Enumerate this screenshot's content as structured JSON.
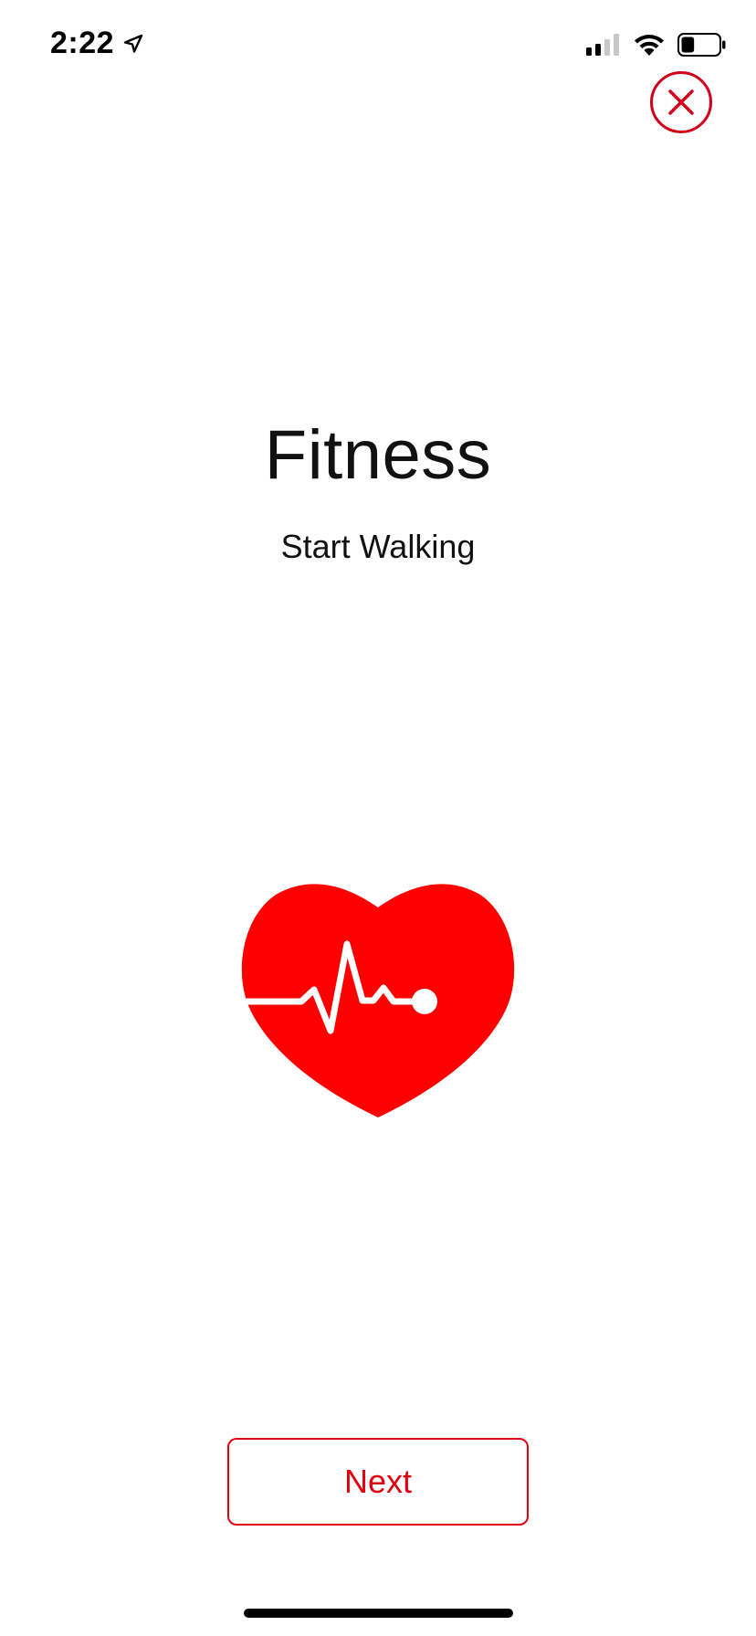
{
  "status_bar": {
    "time": "2:22",
    "location_icon": "location-arrow-icon",
    "signal_icon": "cellular-signal-icon",
    "wifi_icon": "wifi-icon",
    "battery_icon": "battery-icon",
    "battery_level": 0.35
  },
  "header": {
    "close_icon": "close-icon",
    "accent_color": "#d0011b"
  },
  "main": {
    "title": "Fitness",
    "subtitle": "Start Walking",
    "illustration_icon": "heart-pulse-icon",
    "illustration_color": "#ff0000"
  },
  "footer": {
    "next_label": "Next",
    "button_color": "#e0000f"
  }
}
